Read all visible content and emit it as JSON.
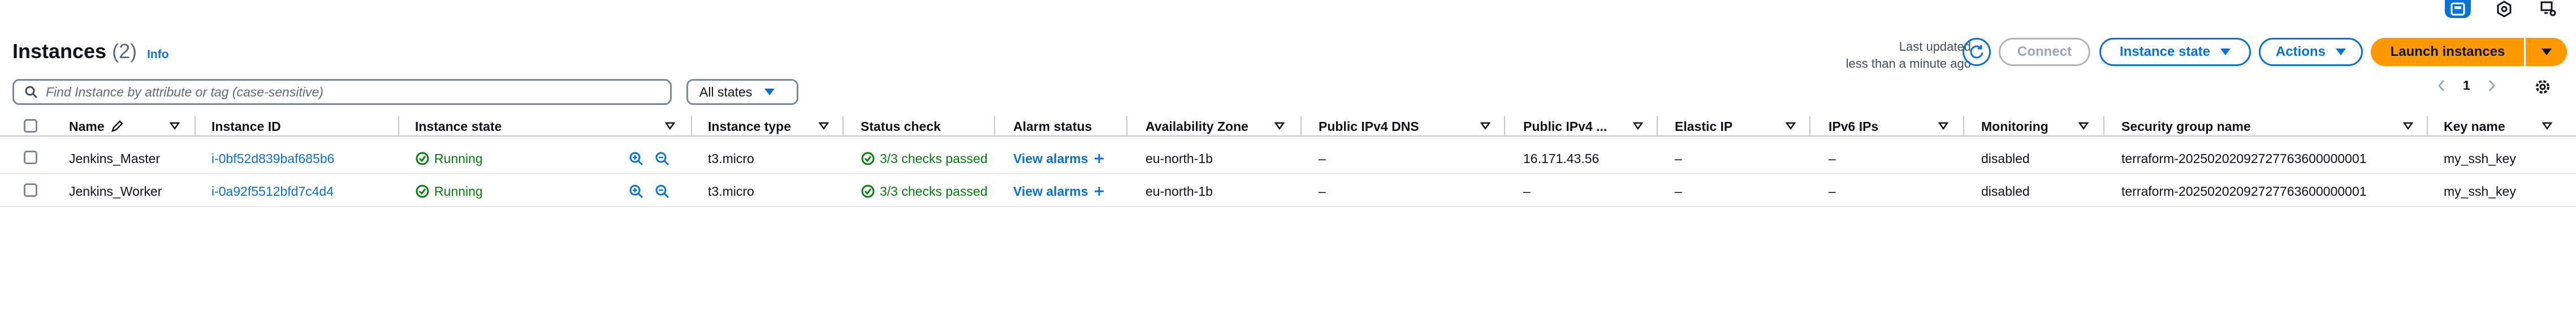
{
  "header": {
    "title": "Instances",
    "count": "(2)",
    "info_link": "Info",
    "last_updated_label": "Last updated",
    "last_updated_value": "less than a minute ago"
  },
  "toolbar": {
    "connect_label": "Connect",
    "instance_state_label": "Instance state",
    "actions_label": "Actions",
    "launch_label": "Launch instances"
  },
  "filter": {
    "search_placeholder": "Find Instance by attribute or tag (case-sensitive)",
    "states_select": "All states"
  },
  "pagination": {
    "current_page": "1"
  },
  "colors": {
    "accent": "#0972d3",
    "primary_button": "#ff9900",
    "running": "#037f0c",
    "disabled_button": "#9ba7b6"
  },
  "table": {
    "columns": [
      "Name",
      "Instance ID",
      "Instance state",
      "Instance type",
      "Status check",
      "Alarm status",
      "Availability Zone",
      "Public IPv4 DNS",
      "Public IPv4 ...",
      "Elastic IP",
      "IPv6 IPs",
      "Monitoring",
      "Security group name",
      "Key name"
    ],
    "rows": [
      {
        "name": "Jenkins_Master",
        "instance_id": "i-0bf52d839baf685b6",
        "state": "Running",
        "type": "t3.micro",
        "status_check": "3/3 checks passed",
        "alarm": "View alarms",
        "az": "eu-north-1b",
        "dns": "–",
        "ipv4": "16.171.43.56",
        "elastic_ip": "–",
        "ipv6": "–",
        "monitoring": "disabled",
        "security_group": "terraform-20250202092727763600000001",
        "key_name": "my_ssh_key"
      },
      {
        "name": "Jenkins_Worker",
        "instance_id": "i-0a92f5512bfd7c4d4",
        "state": "Running",
        "type": "t3.micro",
        "status_check": "3/3 checks passed",
        "alarm": "View alarms",
        "az": "eu-north-1b",
        "dns": "–",
        "ipv4": "–",
        "elastic_ip": "–",
        "ipv6": "–",
        "monitoring": "disabled",
        "security_group": "terraform-20250202092727763600000001",
        "key_name": "my_ssh_key"
      }
    ]
  }
}
